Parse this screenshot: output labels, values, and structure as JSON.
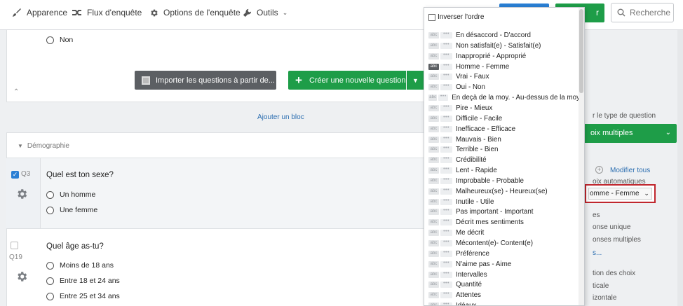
{
  "toolbar": {
    "appearance": "Apparence",
    "survey_flow": "Flux d'enquête",
    "survey_options": "Options de l'enquête",
    "tools": "Outils",
    "green_button_partial": "r",
    "search_placeholder": "Recherche"
  },
  "block_prev": {
    "option_no": "Non",
    "import_button": "Importer les questions à partir de...",
    "create_button": "Créer une nouvelle question",
    "add_block": "Ajouter un bloc"
  },
  "demographics": {
    "section_title": "Démographie",
    "q3": {
      "number": "Q3",
      "title": "Quel est ton sexe?",
      "options": [
        "Un homme",
        "Une femme"
      ]
    },
    "q19": {
      "number": "Q19",
      "title": "Quel âge as-tu?",
      "options": [
        "Moins de 18 ans",
        "Entre 18 et 24 ans",
        "Entre 25 et 34 ans"
      ]
    }
  },
  "right_panel": {
    "question_type_label": "r le type de question",
    "question_type_value": "oix multiples",
    "edit_all": "Modifier tous",
    "auto_choices": "oix automatiques",
    "selected_scale": "omme - Femme",
    "answers_label": "es",
    "single_answer": "onse unique",
    "multiple_answers": "onses multiples",
    "more_link": "s...",
    "position_label": "tion des choix",
    "vertical": "ticale",
    "horizontal": "izontale"
  },
  "dropdown": {
    "invert_label": "Inverser l'ordre",
    "tag_label": "abc",
    "tag2_label": "•••",
    "selected_index": 3,
    "items": [
      "En désaccord - D'accord",
      "Non satisfait(e) - Satisfait(e)",
      "Inapproprié - Approprié",
      "Homme - Femme",
      "Vrai - Faux",
      "Oui - Non",
      "En deçà de la moy. - Au-dessus de la moy.",
      "Pire - Mieux",
      "Difficile - Facile",
      "Inefficace - Efficace",
      "Mauvais - Bien",
      "Terrible - Bien",
      "Crédibilité",
      "Lent - Rapide",
      "Improbable - Probable",
      "Malheureux(se) - Heureux(se)",
      "Inutile - Utile",
      "Pas important - Important",
      "Décrit mes sentiments",
      "Me décrit",
      "Mécontent(e)- Content(e)",
      "Préférence",
      "N'aime pas - Aime",
      "Intervalles",
      "Quantité",
      "Attentes",
      "Idéaux"
    ]
  },
  "colors": {
    "accent_blue": "#2a7fd4",
    "accent_green": "#1e9d48",
    "highlight_red": "#c0262d"
  }
}
